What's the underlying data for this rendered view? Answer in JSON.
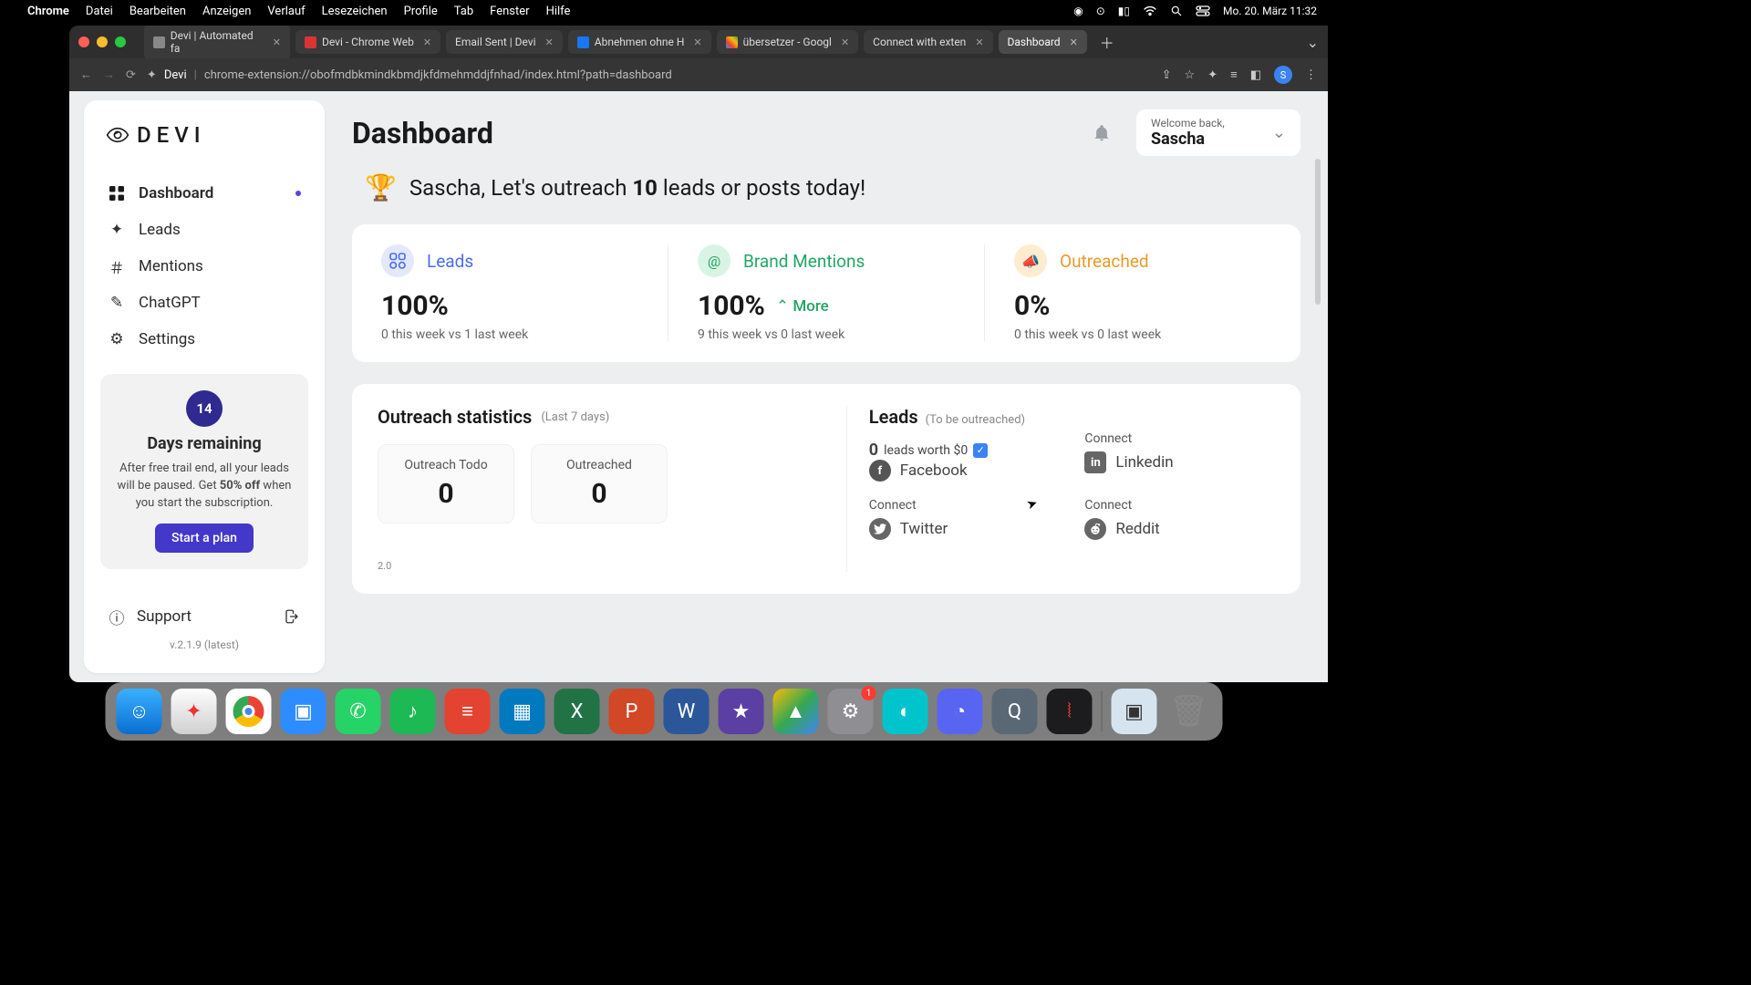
{
  "menubar": {
    "app": "Chrome",
    "items": [
      "Datei",
      "Bearbeiten",
      "Anzeigen",
      "Verlauf",
      "Lesezeichen",
      "Profile",
      "Tab",
      "Fenster",
      "Hilfe"
    ],
    "clock": "Mo. 20. März  11:32"
  },
  "tabs": [
    {
      "label": "Devi | Automated fa",
      "active": false
    },
    {
      "label": "Devi - Chrome Web",
      "active": false
    },
    {
      "label": "Email Sent | Devi",
      "active": false
    },
    {
      "label": "Abnehmen ohne H",
      "active": false
    },
    {
      "label": "übersetzer - Googl",
      "active": false
    },
    {
      "label": "Connect with exten",
      "active": false
    },
    {
      "label": "Dashboard",
      "active": true
    }
  ],
  "url": {
    "prefix": "Devi",
    "path": "chrome-extension://obofmdbkmindkbmdjkfdmehmddjfnhad/index.html?path=dashboard",
    "avatar": "S"
  },
  "sidebar": {
    "brand": "DEVI",
    "items": [
      {
        "label": "Dashboard",
        "active": true
      },
      {
        "label": "Leads",
        "active": false
      },
      {
        "label": "Mentions",
        "active": false
      },
      {
        "label": "ChatGPT",
        "active": false
      },
      {
        "label": "Settings",
        "active": false
      }
    ],
    "upgrade": {
      "days": "14",
      "title": "Days remaining",
      "desc_pre": "After free trail end, all your leads will be paused. Get ",
      "desc_bold": "50% off",
      "desc_post": " when you start the subscription.",
      "cta": "Start a plan"
    },
    "support": "Support",
    "version": "v.2.1.9 (latest)"
  },
  "header": {
    "title": "Dashboard",
    "welcome_label": "Welcome back,",
    "welcome_name": "Sascha"
  },
  "banner": {
    "pre": "Sascha, Let's outreach ",
    "bold": "10",
    "post": " leads or posts today!"
  },
  "cards": {
    "leads": {
      "title": "Leads",
      "pct": "100%",
      "sub": "0 this week vs 1 last week"
    },
    "brand": {
      "title": "Brand Mentions",
      "pct": "100%",
      "more": "More",
      "sub": "9 this week vs 0 last week"
    },
    "out": {
      "title": "Outreached",
      "pct": "0%",
      "sub": "0 this week vs 0 last week"
    }
  },
  "outstat": {
    "title": "Outreach statistics",
    "period": "(Last 7 days)",
    "todo_label": "Outreach Todo",
    "todo_val": "0",
    "done_label": "Outreached",
    "done_val": "0",
    "axis": "2.0"
  },
  "leads": {
    "title": "Leads",
    "sub": "(To be outreached)",
    "worth_count": "0",
    "worth_text": "leads worth $0",
    "connect": "Connect",
    "socials": {
      "fb": "Facebook",
      "li": "Linkedin",
      "tw": "Twitter",
      "rd": "Reddit"
    }
  },
  "dock_badge": "1"
}
